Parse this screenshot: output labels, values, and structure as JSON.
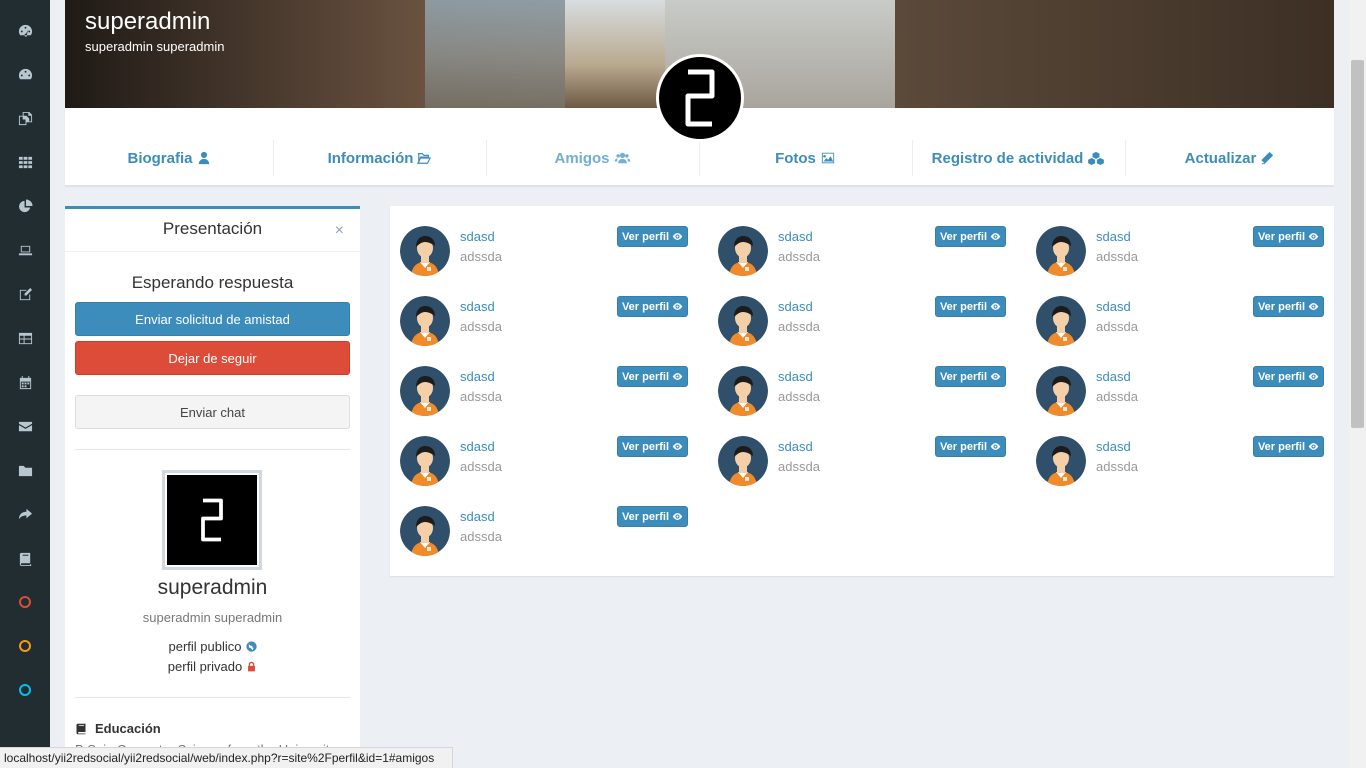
{
  "cover": {
    "username": "superadmin",
    "fullname": "superadmin superadmin"
  },
  "tabs": [
    {
      "label": "Biografia",
      "icon": "user-icon"
    },
    {
      "label": "Información",
      "icon": "folder-open-icon"
    },
    {
      "label": "Amigos",
      "icon": "users-icon"
    },
    {
      "label": "Fotos",
      "icon": "image-icon"
    },
    {
      "label": "Registro de actividad",
      "icon": "cubes-icon"
    },
    {
      "label": "Actualizar",
      "icon": "pencil-icon"
    }
  ],
  "presentation": {
    "title": "Presentación",
    "close": "×",
    "status": "Esperando respuesta",
    "friend_request_label": "Enviar solicitud de amistad",
    "unfollow_label": "Dejar de seguir",
    "chat_label": "Enviar chat",
    "username": "superadmin",
    "fullname": "superadmin superadmin",
    "public_label": "perfil publico",
    "private_label": "perfil privado",
    "education_heading": "Educación",
    "education_text": "B.S. in Computer Science from the University"
  },
  "friends": {
    "button_label": "Ver perfil",
    "items": [
      {
        "name": "sdasd",
        "sub": "adssda"
      },
      {
        "name": "sdasd",
        "sub": "adssda"
      },
      {
        "name": "sdasd",
        "sub": "adssda"
      },
      {
        "name": "sdasd",
        "sub": "adssda"
      },
      {
        "name": "sdasd",
        "sub": "adssda"
      },
      {
        "name": "sdasd",
        "sub": "adssda"
      },
      {
        "name": "sdasd",
        "sub": "adssda"
      },
      {
        "name": "sdasd",
        "sub": "adssda"
      },
      {
        "name": "sdasd",
        "sub": "adssda"
      },
      {
        "name": "sdasd",
        "sub": "adssda"
      },
      {
        "name": "sdasd",
        "sub": "adssda"
      },
      {
        "name": "sdasd",
        "sub": "adssda"
      },
      {
        "name": "sdasd",
        "sub": "adssda"
      }
    ]
  },
  "sidebar_icons": [
    "dashboard-icon",
    "dashboard-icon",
    "copy-icon",
    "th-icon",
    "pie-chart-icon",
    "laptop-icon",
    "edit-icon",
    "table-icon",
    "calendar-icon",
    "envelope-icon",
    "folder-icon",
    "share-icon",
    "book-icon",
    "circle-red-icon",
    "circle-yellow-icon",
    "circle-aqua-icon"
  ],
  "colors": {
    "primary": "#3c8dbc",
    "danger": "#dd4b39",
    "sidebar": "#222d32"
  },
  "status_url": "localhost/yii2redsocial/yii2redsocial/web/index.php?r=site%2Fperfil&id=1#amigos"
}
